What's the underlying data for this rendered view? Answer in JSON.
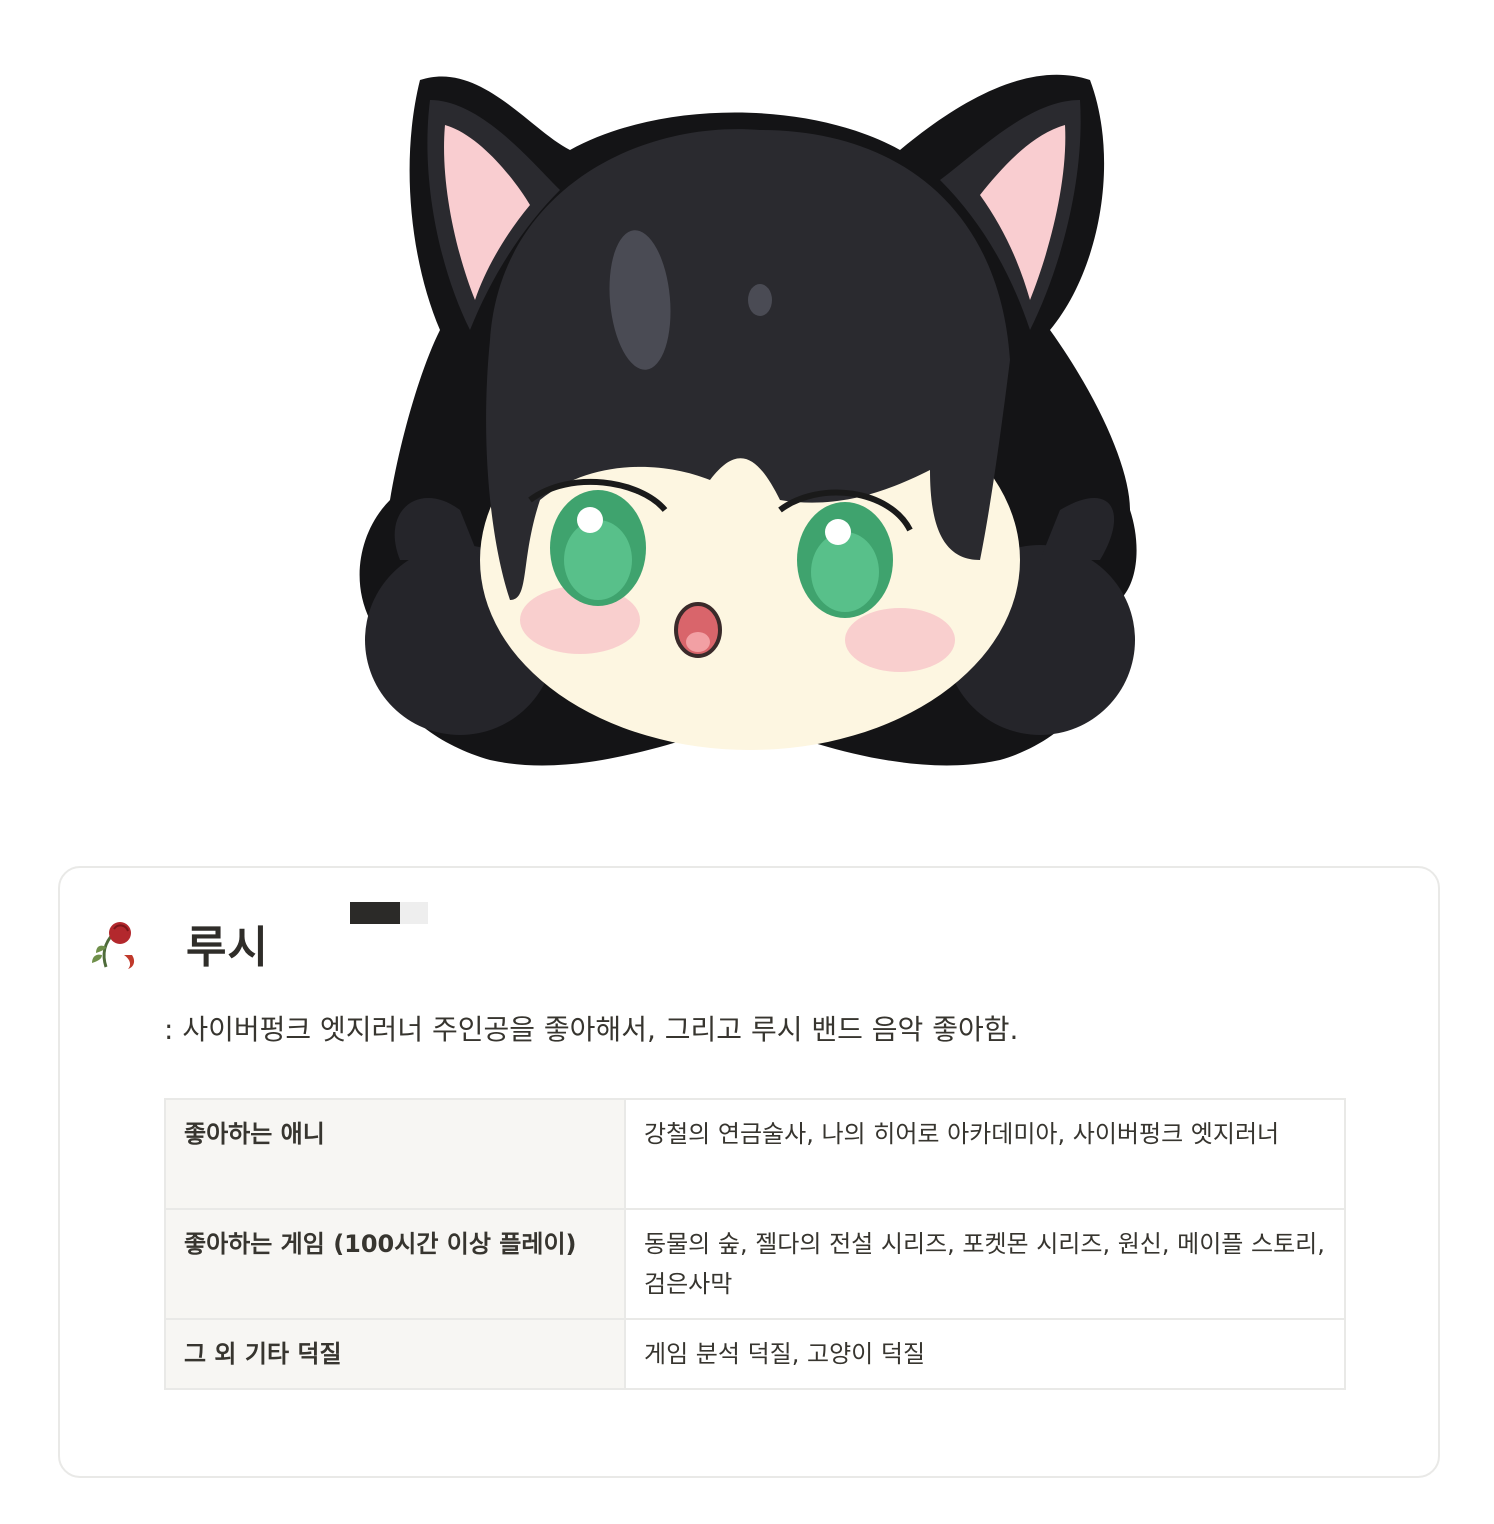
{
  "profile": {
    "name": "루시",
    "description": ": 사이버펑크 엣지러너 주인공을 좋아해서, 그리고 루시 밴드 음악 좋아함.",
    "avatar": "cat-ear-girl-illustration",
    "name_icon": "wilted-rose-icon"
  },
  "table": {
    "rows": [
      {
        "key": "좋아하는 애니",
        "value": "강철의 연금술사, 나의 히어로 아카데미아, 사이버펑크 엣지러너"
      },
      {
        "key": "좋아하는 게임 (100시간 이상 플레이)",
        "value": "동물의 숲, 젤다의 전설 시리즈, 포켓몬 시리즈, 원신, 메이플 스토리, 검은사막"
      },
      {
        "key": "그 외 기타 덕질",
        "value": "게임 분석 덕질, 고양이 덕질"
      }
    ]
  },
  "colors": {
    "hair": "#1f1f23",
    "ear_inner": "#f9cdd0",
    "eyes": "#3fa36e",
    "skin": "#fdf6e1",
    "card_border": "#e9e9e7",
    "key_cell_bg": "#f7f6f3"
  }
}
